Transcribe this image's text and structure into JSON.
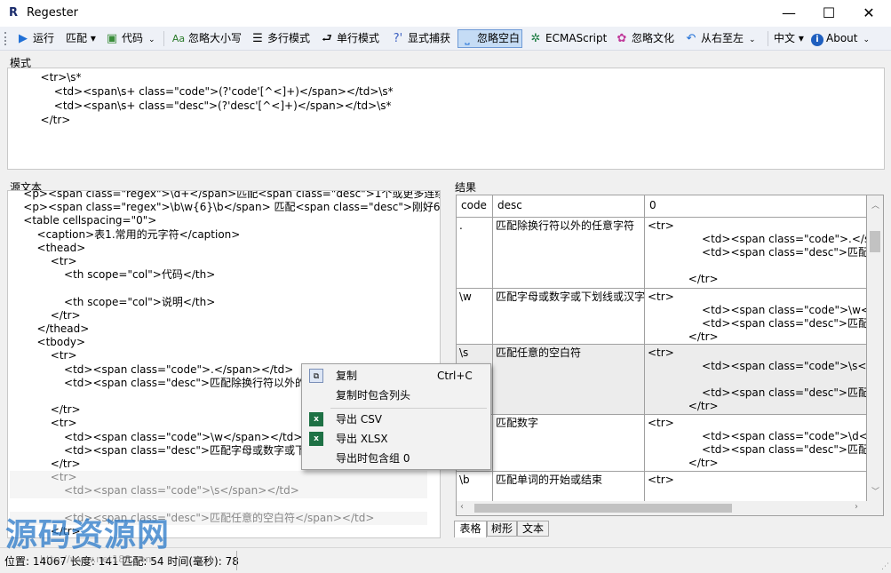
{
  "window": {
    "logo": "R",
    "title": "Regester",
    "min": "—",
    "max": "☐",
    "close": "✕"
  },
  "toolbar": {
    "run": "运行",
    "match": "匹配 ▾",
    "code": "代码",
    "ignore_case": "忽略大小写",
    "multiline": "多行模式",
    "singleline": "单行模式",
    "explicit_capture": "显式捕获",
    "ignore_whitespace": "忽略空白",
    "ecmascript": "ECMAScript",
    "ignore_culture": "忽略文化",
    "rtl": "从右至左",
    "language": "中文 ▾",
    "about": "About"
  },
  "pattern_panel": {
    "label": "模式",
    "lines": [
      "        <tr>\\s*",
      "            <td><span\\s+ class=\"code\">(?'code'[^<]+)</span></td>\\s*",
      "            <td><span\\s+ class=\"desc\">(?'desc'[^<]+)</span></td>\\s*",
      "        </tr>"
    ]
  },
  "source_panel": {
    "label": "源文本",
    "lines": [
      "    <p><span class=\"regex\">\\d+</span>匹配<span class=\"desc\">1个或更多连续的数",
      "    <p><span class=\"regex\">\\b\\w{6}\\b</span> 匹配<span class=\"desc\">刚好6个字符",
      "    <table cellspacing=\"0\">",
      "        <caption>表1.常用的元字符</caption>",
      "        <thead>",
      "            <tr>",
      "                <th scope=\"col\">代码</th>",
      "",
      "                <th scope=\"col\">说明</th>",
      "            </tr>",
      "        </thead>",
      "        <tbody>",
      "            <tr>",
      "                <td><span class=\"code\">.</span></td>",
      "                <td><span class=\"desc\">匹配除换行符以外的任",
      "",
      "            </tr>",
      "            <tr>",
      "                <td><span class=\"code\">\\w</span></td>",
      "                <td><span class=\"desc\">匹配字母或数字或下划",
      "            </tr>",
      "            <tr>",
      "                <td><span class=\"code\">\\s</span></td>",
      "",
      "                <td><span class=\"desc\">匹配任意的空白符</span></td>",
      "            </tr>"
    ]
  },
  "results_panel": {
    "label": "结果",
    "columns": [
      "code",
      "desc",
      "0"
    ],
    "rows": [
      {
        "code": ".",
        "desc": "匹配除换行符以外的任意字符",
        "match": "<tr>\n                <td><span class=\"code\">.</span>\n                <td><span class=\"desc\">匹配除\n\n            </tr>"
      },
      {
        "code": "\\w",
        "desc": "匹配字母或数字或下划线或汉字",
        "match": "<tr>\n                <td><span class=\"code\">\\w</span>\n                <td><span class=\"desc\">匹配字母\n            </tr>"
      },
      {
        "code": "\\s",
        "desc": "匹配任意的空白符",
        "match": "<tr>\n                <td><span class=\"code\">\\s</span>\n\n                <td><span class=\"desc\">匹配任\n            </tr>"
      },
      {
        "code": "\\d",
        "desc": "匹配数字",
        "match": "<tr>\n                <td><span class=\"code\">\\d</span>\n                <td><span class=\"desc\">匹配数\n            </tr>"
      },
      {
        "code": "\\b",
        "desc": "匹配单词的开始或结束",
        "match": "<tr>"
      }
    ],
    "tabs": [
      "表格",
      "树形",
      "文本"
    ]
  },
  "context_menu": {
    "copy": "复制",
    "copy_shortcut": "Ctrl+C",
    "copy_with_headers": "复制时包含列头",
    "export_csv": "导出 CSV",
    "export_xlsx": "导出 XLSX",
    "export_group0": "导出时包含组 0"
  },
  "status": {
    "text": "位置: 14067 长度: 141   匹配: 54 时间(毫秒): 78"
  },
  "watermark": {
    "text": "源码资源网",
    "url": "http://www.net188.com"
  }
}
